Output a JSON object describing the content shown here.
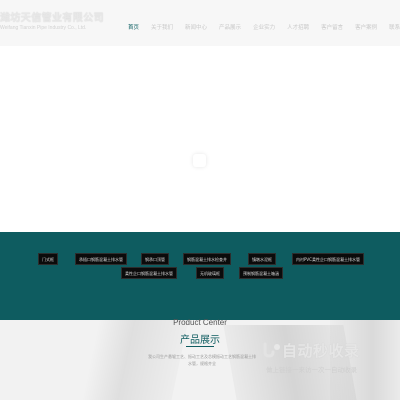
{
  "header": {
    "company_cn": "潍坊天信管业有限公司",
    "company_en": "Weifang Tianxin Pipe Industry Co., Ltd."
  },
  "nav": {
    "items": [
      {
        "label": "首页",
        "active": true
      },
      {
        "label": "关于我们",
        "active": false
      },
      {
        "label": "新闻中心",
        "active": false
      },
      {
        "label": "产品展示",
        "active": false
      },
      {
        "label": "企业实力",
        "active": false
      },
      {
        "label": "人才招聘",
        "active": false
      },
      {
        "label": "客户留言",
        "active": false
      },
      {
        "label": "客户案例",
        "active": false
      },
      {
        "label": "联系方式",
        "active": false
      }
    ]
  },
  "categories": {
    "row1": [
      "门式框",
      "承插口钢筋混凝土排水管",
      "钢承口顶管",
      "钢筋混凝土排水检查井",
      "镇墩水泥框",
      "内衬PVC柔性企口钢筋混凝土排水管"
    ],
    "row2": [
      "柔性企口钢筋混凝土排水管",
      "无机玻璃框",
      "预制钢筋混凝土箱涵"
    ]
  },
  "products": {
    "title_en": "Product Center",
    "title_cn": "产品展示",
    "desc": "我公司生产悬辊工艺、振动工艺及芯模振动工艺钢筋混凝土排水管，规格齐全"
  },
  "watermark": {
    "title": "自动秒收录",
    "subtitle": "做上链接一来访一次一自动收录"
  },
  "colors": {
    "brand_teal": "#0e5c60",
    "tag_bg": "#0b0b0b"
  }
}
